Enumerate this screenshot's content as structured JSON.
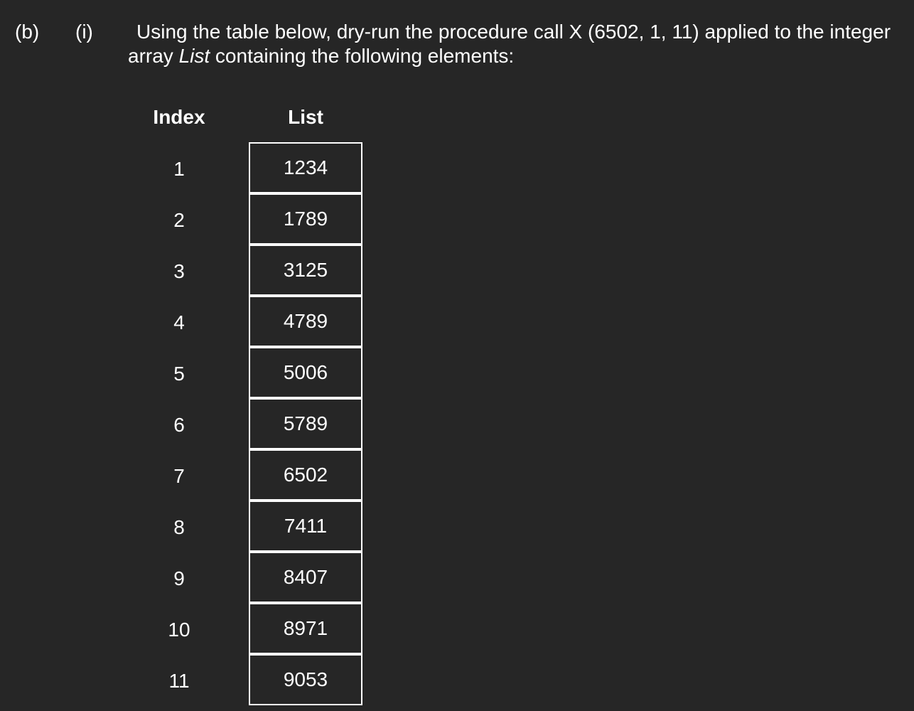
{
  "question": {
    "part": "(b)",
    "subpart": "(i)",
    "text_before": "Using the table below, dry-run the procedure call X (6502, 1, 11) applied to the integer array ",
    "array_name": "List",
    "text_after": " containing the following elements:"
  },
  "table": {
    "index_header": "Index",
    "list_header": "List",
    "rows": [
      {
        "index": "1",
        "value": "1234"
      },
      {
        "index": "2",
        "value": "1789"
      },
      {
        "index": "3",
        "value": "3125"
      },
      {
        "index": "4",
        "value": "4789"
      },
      {
        "index": "5",
        "value": "5006"
      },
      {
        "index": "6",
        "value": "5789"
      },
      {
        "index": "7",
        "value": "6502"
      },
      {
        "index": "8",
        "value": "7411"
      },
      {
        "index": "9",
        "value": "8407"
      },
      {
        "index": "10",
        "value": "8971"
      },
      {
        "index": "11",
        "value": "9053"
      }
    ]
  }
}
